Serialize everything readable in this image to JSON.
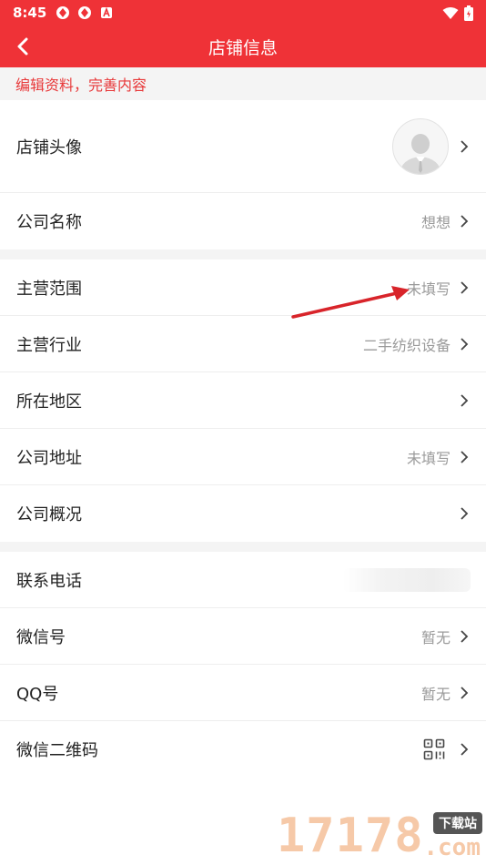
{
  "status": {
    "time": "8:45"
  },
  "nav": {
    "title": "店铺信息"
  },
  "tip": "编辑资料，完善内容",
  "rows": {
    "avatar": {
      "label": "店铺头像"
    },
    "company_name": {
      "label": "公司名称",
      "value": "想想"
    },
    "main_scope": {
      "label": "主营范围",
      "value": "未填写"
    },
    "main_industry": {
      "label": "主营行业",
      "value": "二手纺织设备"
    },
    "region": {
      "label": "所在地区"
    },
    "address": {
      "label": "公司地址",
      "value": "未填写"
    },
    "overview": {
      "label": "公司概况"
    },
    "phone": {
      "label": "联系电话"
    },
    "wechat": {
      "label": "微信号",
      "value": "暂无"
    },
    "qq": {
      "label": "QQ号",
      "value": "暂无"
    },
    "wechat_qr": {
      "label": "微信二维码"
    }
  },
  "watermark": {
    "number": "17178",
    "badge": "下载站",
    "suffix": ".com"
  },
  "colors": {
    "brand_red": "#ef3237",
    "tip_red": "#e8393a",
    "annotation_arrow": "#d8242a"
  }
}
